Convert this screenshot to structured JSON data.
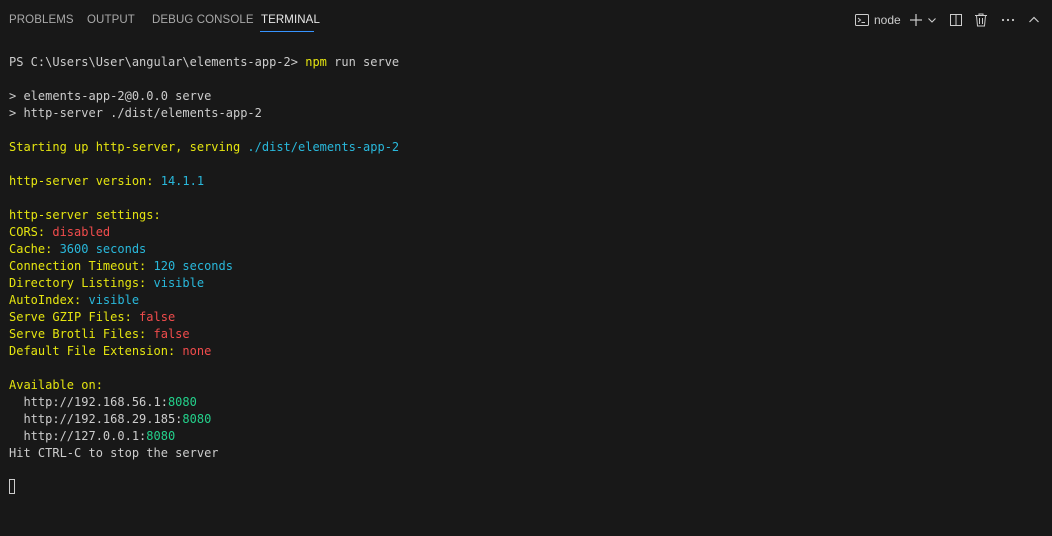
{
  "tabs": [
    {
      "label": "PROBLEMS"
    },
    {
      "label": "OUTPUT"
    },
    {
      "label": "DEBUG CONSOLE"
    },
    {
      "label": "TERMINAL",
      "active": true
    }
  ],
  "toolbar": {
    "shell_label": "node",
    "icons": [
      "terminal-icon",
      "plus-icon",
      "chevron-down-icon",
      "split-icon",
      "trash-icon",
      "more-icon",
      "chevron-up-icon"
    ]
  },
  "colors": {
    "background": "#181818",
    "accent": "#3794ff",
    "yellow": "#e5e510",
    "blue": "#29b8db",
    "red": "#f14c4c",
    "green": "#23d18b",
    "default": "#cccccc"
  },
  "terminal": {
    "prompt": {
      "path": "PS C:\\Users\\User\\angular\\elements-app-2> ",
      "cmd": "npm",
      "args": " run serve"
    },
    "npm_line1": "> elements-app-2@0.0.0 serve",
    "npm_line2": "> http-server ./dist/elements-app-2",
    "starting": {
      "text": "Starting up http-server, serving ",
      "path": "./dist/elements-app-2"
    },
    "version": {
      "label": "http-server version: ",
      "value": "14.1.1"
    },
    "settings_header": "http-server settings: ",
    "settings": [
      {
        "label": "CORS: ",
        "value": "disabled"
      },
      {
        "label": "Cache: ",
        "value": "3600 seconds"
      },
      {
        "label": "Connection Timeout: ",
        "value": "120 seconds"
      },
      {
        "label": "Directory Listings: ",
        "value": "visible"
      },
      {
        "label": "AutoIndex: ",
        "value": "visible"
      },
      {
        "label": "Serve GZIP Files: ",
        "value": "false"
      },
      {
        "label": "Serve Brotli Files: ",
        "value": "false"
      },
      {
        "label": "Default File Extension: ",
        "value": "none"
      }
    ],
    "available_header": "Available on:",
    "addresses": [
      {
        "host": "  http://192.168.56.1:",
        "port": "8080"
      },
      {
        "host": "  http://192.168.29.185:",
        "port": "8080"
      },
      {
        "host": "  http://127.0.0.1:",
        "port": "8080"
      }
    ],
    "stop_hint": "Hit CTRL-C to stop the server"
  }
}
